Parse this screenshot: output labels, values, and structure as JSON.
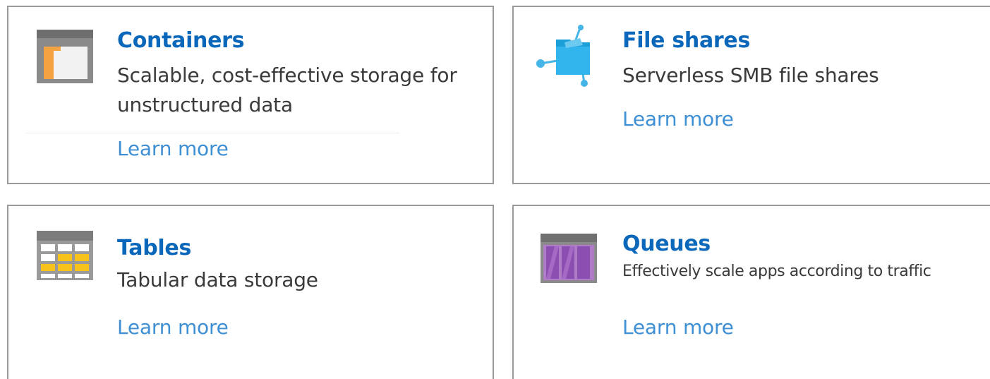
{
  "cards": [
    {
      "title": "Containers",
      "description": "Scalable, cost-effective storage for unstructured data",
      "link": "Learn more",
      "icon": "containers-icon"
    },
    {
      "title": "File shares",
      "description": "Serverless SMB file shares",
      "link": "Learn more",
      "icon": "file-shares-icon"
    },
    {
      "title": "Tables",
      "description": "Tabular data storage",
      "link": "Learn more",
      "icon": "tables-icon"
    },
    {
      "title": "Queues",
      "description": "Effectively scale apps according to traffic",
      "link": "Learn more",
      "icon": "queues-icon"
    }
  ],
  "colors": {
    "title": "#0b67b9",
    "link": "#3f8fd4",
    "text": "#3a3a3a",
    "border": "#9a9a9a"
  }
}
